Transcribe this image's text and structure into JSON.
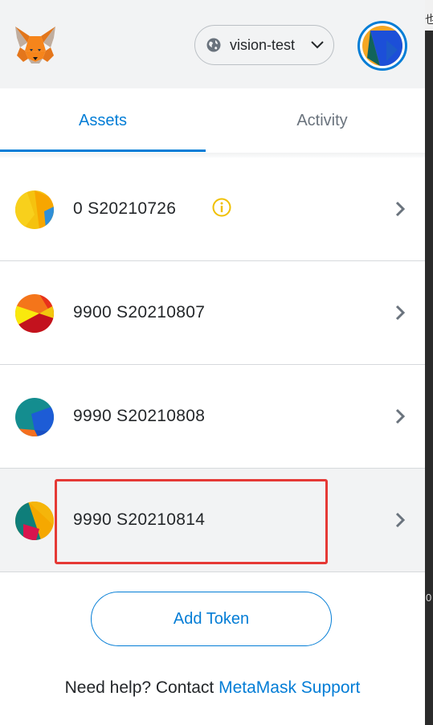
{
  "header": {
    "network_name": "vision-test",
    "network_icon": "globe-icon",
    "colors": {
      "accent": "#037dd6",
      "header_bg": "#f2f3f4"
    }
  },
  "tabs": [
    {
      "label": "Assets",
      "active": true
    },
    {
      "label": "Activity",
      "active": false
    }
  ],
  "tokens": [
    {
      "amount": "0",
      "symbol": "S20210726",
      "display": "0 S20210726",
      "warning": true
    },
    {
      "amount": "9900",
      "symbol": "S20210807",
      "display": "9900 S20210807",
      "warning": false
    },
    {
      "amount": "9990",
      "symbol": "S20210808",
      "display": "9990 S20210808",
      "warning": false
    },
    {
      "amount": "9990",
      "symbol": "S20210814",
      "display": "9990 S20210814",
      "warning": false,
      "highlighted": true
    }
  ],
  "actions": {
    "add_token": "Add Token"
  },
  "footer": {
    "help_prefix": "Need help? Contact ",
    "help_link": "MetaMask Support"
  },
  "edge": {
    "glyph_top": "也",
    "glyph_mid": "0"
  }
}
